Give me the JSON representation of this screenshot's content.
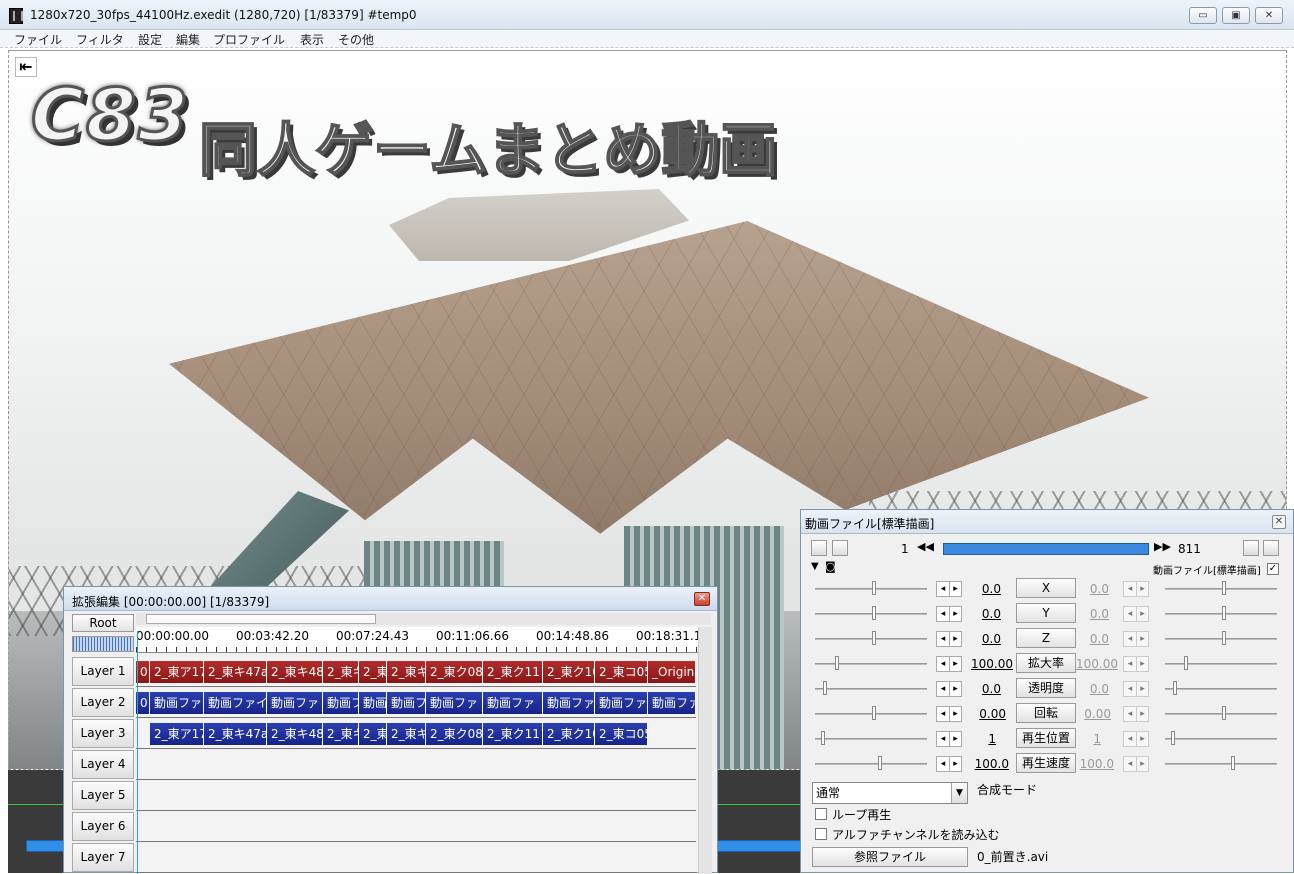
{
  "window": {
    "title": "1280x720_30fps_44100Hz.exedit (1280,720)  [1/83379]  #temp0",
    "minimize": "▭",
    "maximize": "▣",
    "close": "✕"
  },
  "menu": [
    "ファイル",
    "フィルタ",
    "設定",
    "編集",
    "プロファイル",
    "表示",
    "その他"
  ],
  "preview": {
    "back_icon": "⇤",
    "overlay_c83": "C83",
    "overlay_title": "同人ゲームまとめ動画"
  },
  "timeline": {
    "title": "拡張編集 [00:00:00.00] [1/83379]",
    "close": "✕",
    "root_label": "Root",
    "ruler": [
      "00:00:00.00",
      "00:03:42.20",
      "00:07:24.43",
      "00:11:06.66",
      "00:14:48.86",
      "00:18:31.1"
    ],
    "layers": [
      "Layer 1",
      "Layer 2",
      "Layer 3",
      "Layer 4",
      "Layer 5",
      "Layer 6",
      "Layer 7"
    ],
    "layer1_clips": [
      "0",
      "2_東ア17",
      "2_東キ47a",
      "2_東キ48",
      "2_東キ",
      "2_東",
      "2_東キ",
      "2_東ク08",
      "2_東ク11",
      "2_東ク10",
      "2_東コ05",
      "_Origina"
    ],
    "layer2_clips": [
      "0",
      "動画ファ",
      "動画ファイ",
      "動画ファ",
      "動画フ",
      "動画",
      "動画フ",
      "動画ファ",
      "動画ファ",
      "動画ファ",
      "動画ファ",
      "動画ファ"
    ],
    "layer3_clips": [
      "2_東ア17",
      "2_東キ47a",
      "2_東キ48",
      "2_東キ",
      "2_東",
      "2_東キ",
      "2_東ク08",
      "2_東ク11",
      "2_東ク10",
      "2_東コ05"
    ]
  },
  "props": {
    "title": "動画ファイル[標準描画]",
    "close": "✕",
    "frame_start": "1",
    "frame_end": "811",
    "prev_icon": "◀◀",
    "next_icon": "▶▶",
    "object_label": "動画ファイル[標準描画]",
    "params": [
      {
        "name": "X",
        "left": "0.0",
        "right": "0.0"
      },
      {
        "name": "Y",
        "left": "0.0",
        "right": "0.0"
      },
      {
        "name": "Z",
        "left": "0.0",
        "right": "0.0"
      },
      {
        "name": "拡大率",
        "left": "100.00",
        "right": "100.00"
      },
      {
        "name": "透明度",
        "left": "0.0",
        "right": "0.0"
      },
      {
        "name": "回転",
        "left": "0.00",
        "right": "0.00"
      },
      {
        "name": "再生位置",
        "left": "1",
        "right": "1"
      },
      {
        "name": "再生速度",
        "left": "100.0",
        "right": "100.0"
      }
    ],
    "blend_value": "通常",
    "blend_label": "合成モード",
    "loop_label": "ループ再生",
    "alpha_label": "アルファチャンネルを読み込む",
    "ref_button": "参照ファイル",
    "ref_file": "0_前置き.avi"
  },
  "colors": {
    "clip_red": "#8a1616",
    "clip_blue": "#17248a",
    "frame_bar": "#3b8ae0"
  }
}
